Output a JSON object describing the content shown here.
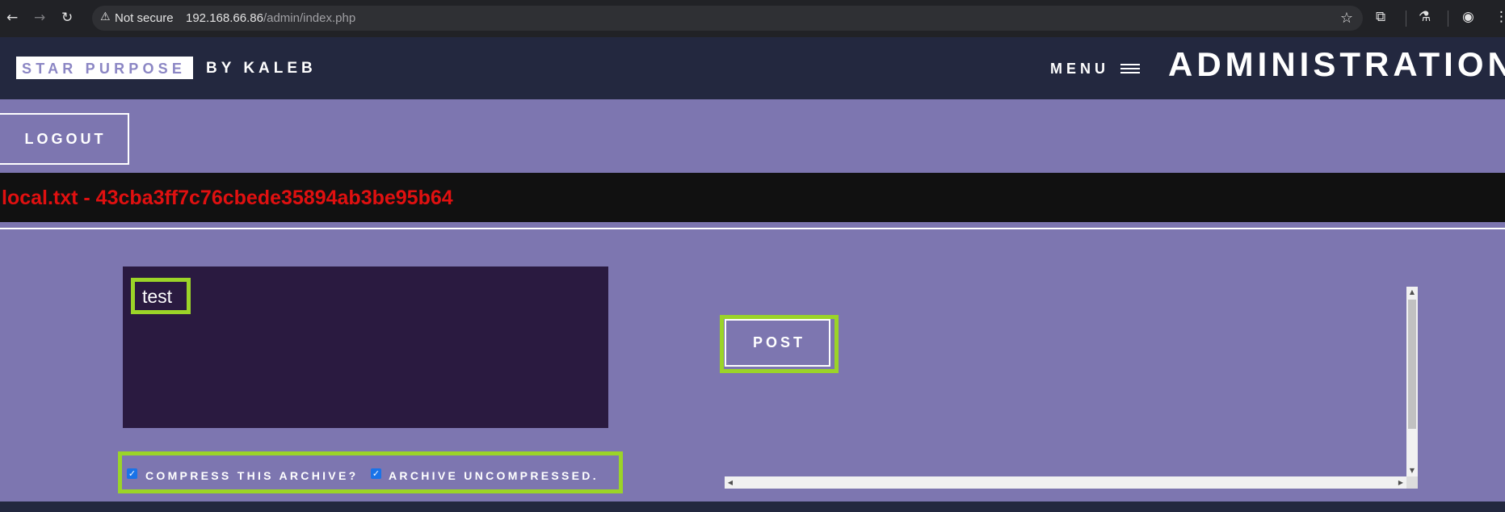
{
  "browser": {
    "security_label": "Not secure",
    "url_host": "192.168.66.86",
    "url_path": "/admin/index.php"
  },
  "header": {
    "brand": "STAR PURPOSE",
    "brand_suffix": "BY KALEB",
    "menu_label": "MENU",
    "page_title": "ADMINISTRATION"
  },
  "logout_label": "LOGOUT",
  "flag_text": "local.txt - 43cba3ff7c76cbede35894ab3be95b64",
  "form": {
    "textarea_value": "test",
    "post_label": "POST",
    "compress_label": "COMPRESS THIS ARCHIVE?",
    "compress_checked": true,
    "uncompressed_label": "ARCHIVE UNCOMPRESSED.",
    "uncompressed_checked": true
  },
  "colors": {
    "page_bg": "#7d76b0",
    "header_bg": "#23283f",
    "flag_text": "#e01010",
    "highlight": "#9bd428",
    "textarea_bg": "#2a1a40"
  }
}
